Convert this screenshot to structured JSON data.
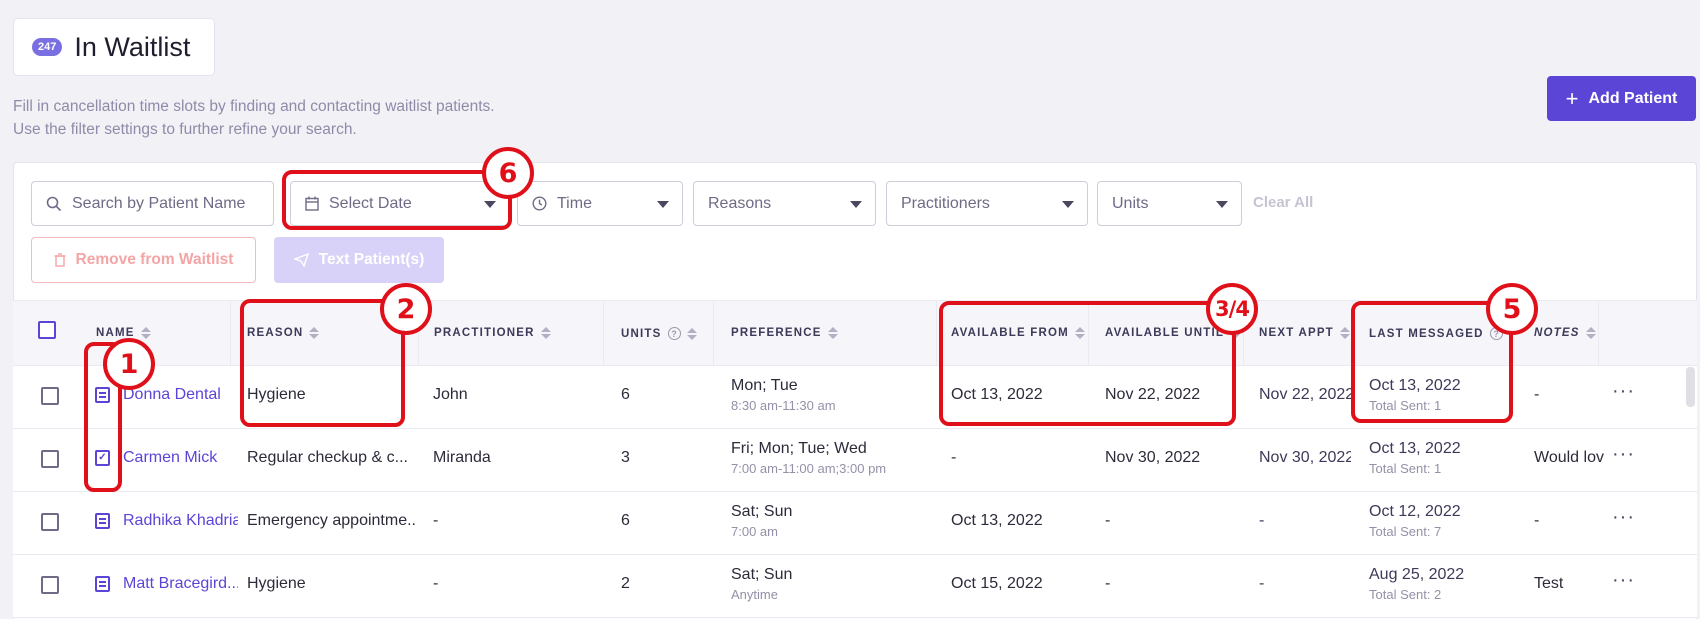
{
  "header": {
    "count": "247",
    "title": "In Waitlist",
    "description_line1": "Fill in cancellation time slots by finding and contacting waitlist patients.",
    "description_line2": "Use the filter settings to further refine your search.",
    "add_button": "Add Patient"
  },
  "filters": {
    "search_placeholder": "Search by Patient Name",
    "date": "Select Date",
    "time": "Time",
    "reasons": "Reasons",
    "practitioners": "Practitioners",
    "units": "Units",
    "clear_all": "Clear All"
  },
  "actions": {
    "remove": "Remove from Waitlist",
    "text": "Text Patient(s)"
  },
  "columns": {
    "name": "NAME",
    "reason": "REASON",
    "practitioner": "PRACTITIONER",
    "units": "UNITS",
    "preference": "PREFERENCE",
    "available_from": "AVAILABLE FROM",
    "available_until": "AVAILABLE UNTIL",
    "next_appt": "NEXT APPT",
    "last_messaged": "LAST MESSAGED",
    "notes": "NOTES"
  },
  "rows": [
    {
      "name": "Donna Dental",
      "reason": "Hygiene",
      "practitioner": "John",
      "units": "6",
      "pref_days": "Mon; Tue",
      "pref_time": "8:30 am-11:30 am",
      "available_from": "Oct 13, 2022",
      "available_until": "Nov 22, 2022",
      "next_appt": "Nov 22, 2022",
      "last_messaged": "Oct 13, 2022",
      "total_sent": "Total Sent: 1",
      "notes": "-",
      "icon": "note-icon"
    },
    {
      "name": "Carmen Mick",
      "reason": "Regular checkup & c...",
      "practitioner": "Miranda",
      "units": "3",
      "pref_days": "Fri; Mon; Tue; Wed",
      "pref_time": "7:00 am-11:00 am;3:00 pm",
      "available_from": "-",
      "available_until": "Nov 30, 2022",
      "next_appt": "Nov 30, 2022",
      "last_messaged": "Oct 13, 2022",
      "total_sent": "Total Sent: 1",
      "notes": "Would lov",
      "icon": "calendar-check-icon"
    },
    {
      "name": "Radhika Khadria",
      "reason": "Emergency appointme...",
      "practitioner": "-",
      "units": "6",
      "pref_days": "Sat; Sun",
      "pref_time": "7:00 am",
      "available_from": "Oct 13, 2022",
      "available_until": "-",
      "next_appt": "-",
      "last_messaged": "Oct 12, 2022",
      "total_sent": "Total Sent: 7",
      "notes": "-",
      "icon": "note-icon"
    },
    {
      "name": "Matt Bracegird...",
      "reason": "Hygiene",
      "practitioner": "-",
      "units": "2",
      "pref_days": "Sat; Sun",
      "pref_time": "Anytime",
      "available_from": "Oct 15, 2022",
      "available_until": "-",
      "next_appt": "-",
      "last_messaged": "Aug 25, 2022",
      "total_sent": "Total Sent: 2",
      "notes": "Test",
      "icon": "note-icon"
    }
  ],
  "annotations": {
    "a1": "1",
    "a2": "2",
    "a34": "3/4",
    "a5": "5",
    "a6": "6"
  },
  "colors": {
    "accent": "#5b45d6",
    "annotation": "#e0101a"
  }
}
